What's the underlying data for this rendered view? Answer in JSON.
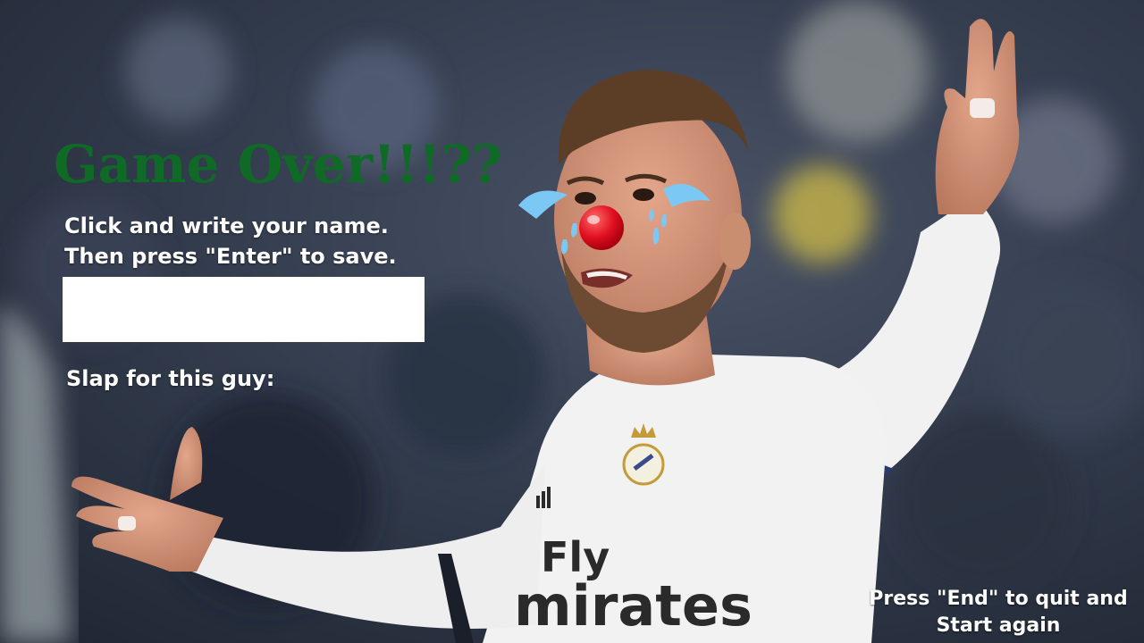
{
  "screen": {
    "title": "Game Over!!!??",
    "instruction_line1": "Click and write your name.",
    "instruction_line2": "Then press \"Enter\" to save.",
    "name_input": {
      "value": "",
      "placeholder": ""
    },
    "slap_label": "Slap for this guy:",
    "quit_hint_line1": "Press \"End\" to quit and",
    "quit_hint_line2": "Start again"
  },
  "jersey_text": {
    "line1": "Fly",
    "line2": "mirates"
  },
  "colors": {
    "title": "#0f6a26",
    "text": "#ffffff",
    "input_bg": "#ffffff",
    "clown_nose": "#e01020",
    "tears": "#7cc8f4",
    "jersey": "#f2f2f2"
  },
  "icons": [
    "clown-nose-icon",
    "crying-tears-icon",
    "club-crest-icon"
  ]
}
